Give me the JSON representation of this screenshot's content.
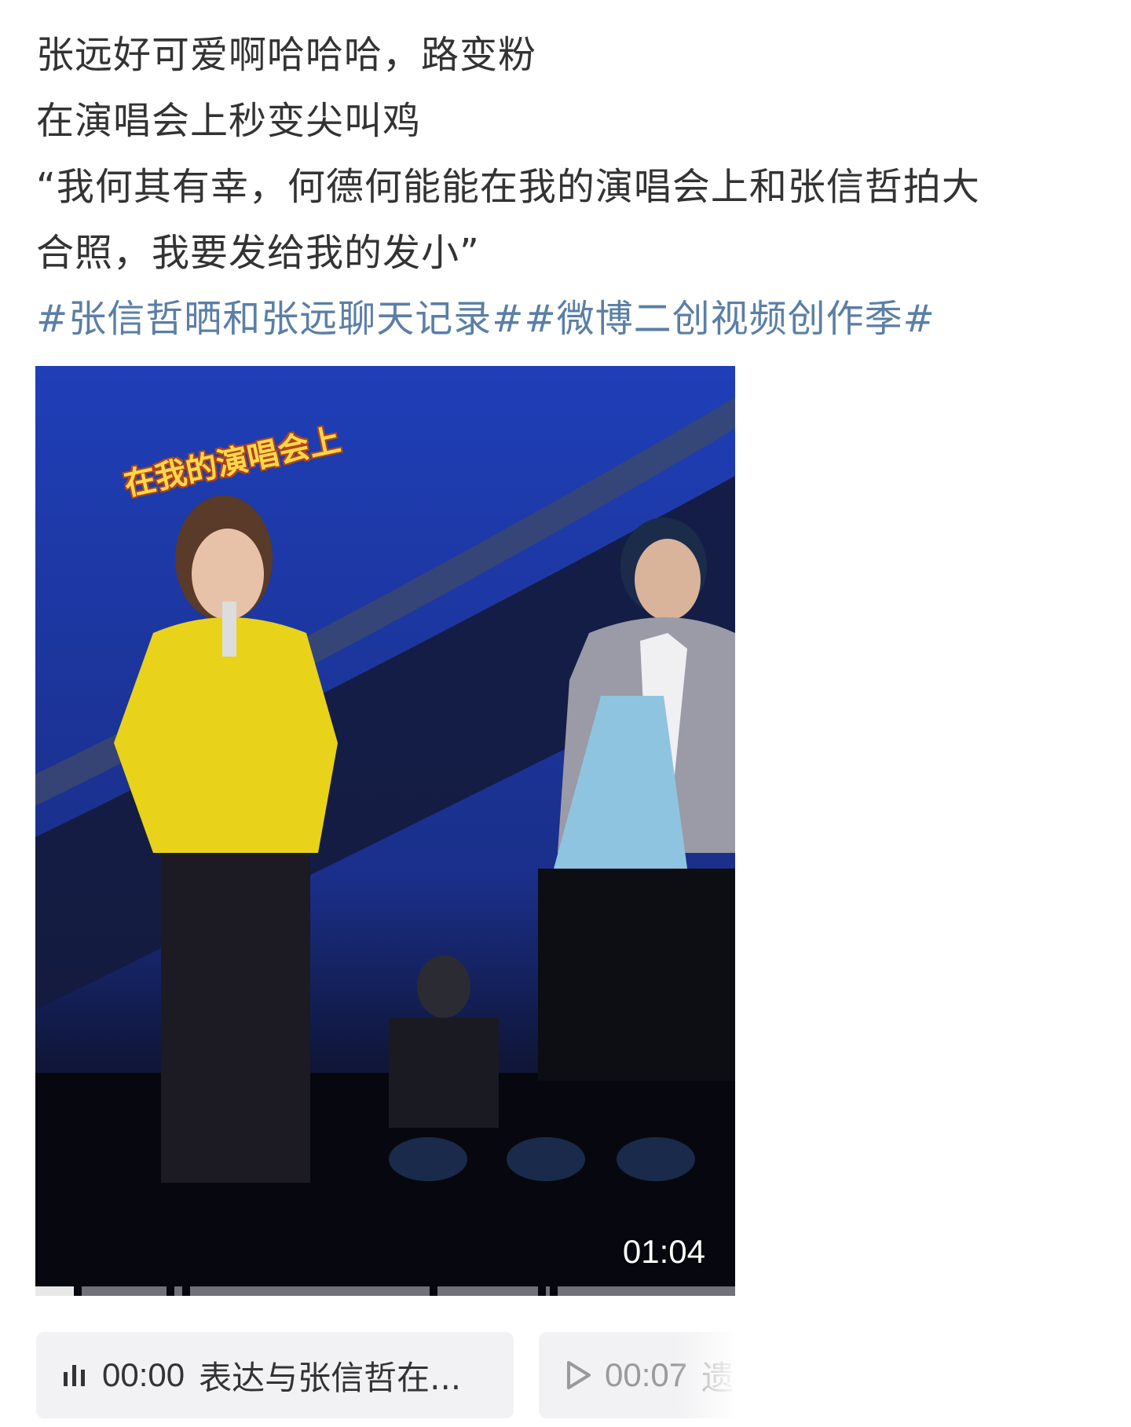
{
  "post": {
    "lines": [
      "张远好可爱啊哈哈哈，路变粉",
      "在演唱会上秒变尖叫鸡",
      "“我何其有幸，何德何能能在我的演唱会上和张信哲拍大",
      "合照，我要发给我的发小”"
    ],
    "hashtags": [
      "#张信哲晒和张远聊天记录#",
      "#微博二创视频创作季#"
    ]
  },
  "video": {
    "caption_sticker": "在我的演唱会上",
    "duration": "01:04",
    "progress_segments": 7,
    "played_segments": 1
  },
  "audio_cards": [
    {
      "icon": "audio-bars-icon",
      "time": "00:00",
      "text": "表达与张信哲在..."
    },
    {
      "icon": "play-icon",
      "time": "00:07",
      "text": "遗"
    }
  ]
}
